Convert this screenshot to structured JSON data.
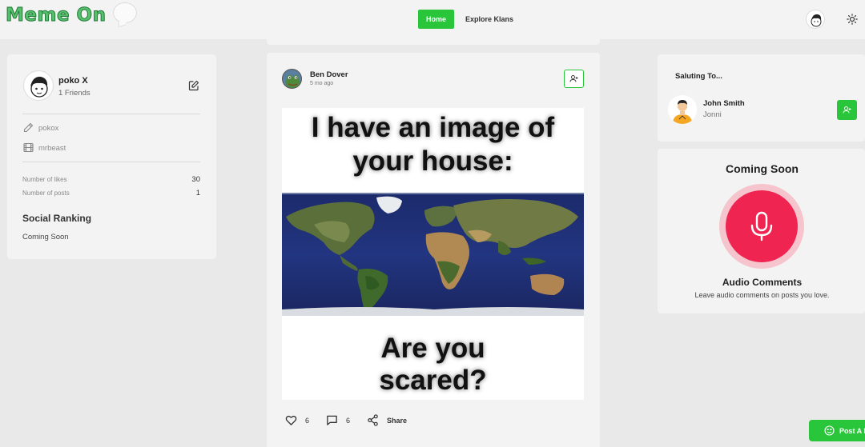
{
  "app": {
    "logo_text": "Meme On",
    "accent_color": "#29c63c"
  },
  "nav": {
    "home_label": "Home",
    "explore_label": "Explore Klans"
  },
  "profile": {
    "name": "poko X",
    "friends": "1 Friends",
    "username": "pokox",
    "favorite": "mrbeast",
    "likes_label": "Number of likes",
    "likes_value": "30",
    "posts_label": "Number of posts",
    "posts_value": "1",
    "ranking_title": "Social Ranking",
    "ranking_text": "Coming Soon"
  },
  "post": {
    "author": "Ben Dover",
    "time": "5 mo ago",
    "meme_top_line1": "I have an image of",
    "meme_top_line2": "your house:",
    "meme_bottom_line1": "Are you",
    "meme_bottom_line2": "scared?",
    "likes": "6",
    "comments": "6",
    "share_label": "Share"
  },
  "saluting": {
    "title": "Saluting To...",
    "name": "John Smith",
    "username": "Jonni"
  },
  "coming_soon": {
    "title": "Coming Soon",
    "feature_title": "Audio Comments",
    "feature_desc": "Leave audio comments on posts you love.",
    "mic_color": "#ef2450"
  },
  "post_button": {
    "label": "Post A M"
  }
}
